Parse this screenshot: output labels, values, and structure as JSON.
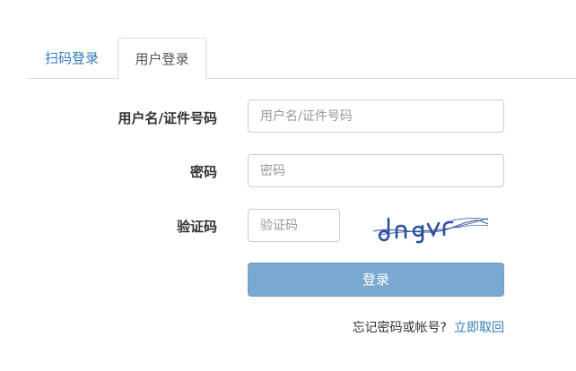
{
  "tabs": [
    {
      "label": "扫码登录",
      "active": false
    },
    {
      "label": "用户登录",
      "active": true
    }
  ],
  "form": {
    "username": {
      "label": "用户名/证件号码",
      "placeholder": "用户名/证件号码",
      "value": ""
    },
    "password": {
      "label": "密码",
      "placeholder": "密码",
      "value": ""
    },
    "captcha": {
      "label": "验证码",
      "placeholder": "验证码",
      "value": "",
      "image_text": "dngvr"
    },
    "submit_label": "登录"
  },
  "footer": {
    "forgot_text": "忘记密码或帐号?",
    "recover_link": "立即取回"
  },
  "colors": {
    "link": "#337ab7",
    "button": "#7aa8d0",
    "captcha_ink": "#2b4f9e"
  }
}
